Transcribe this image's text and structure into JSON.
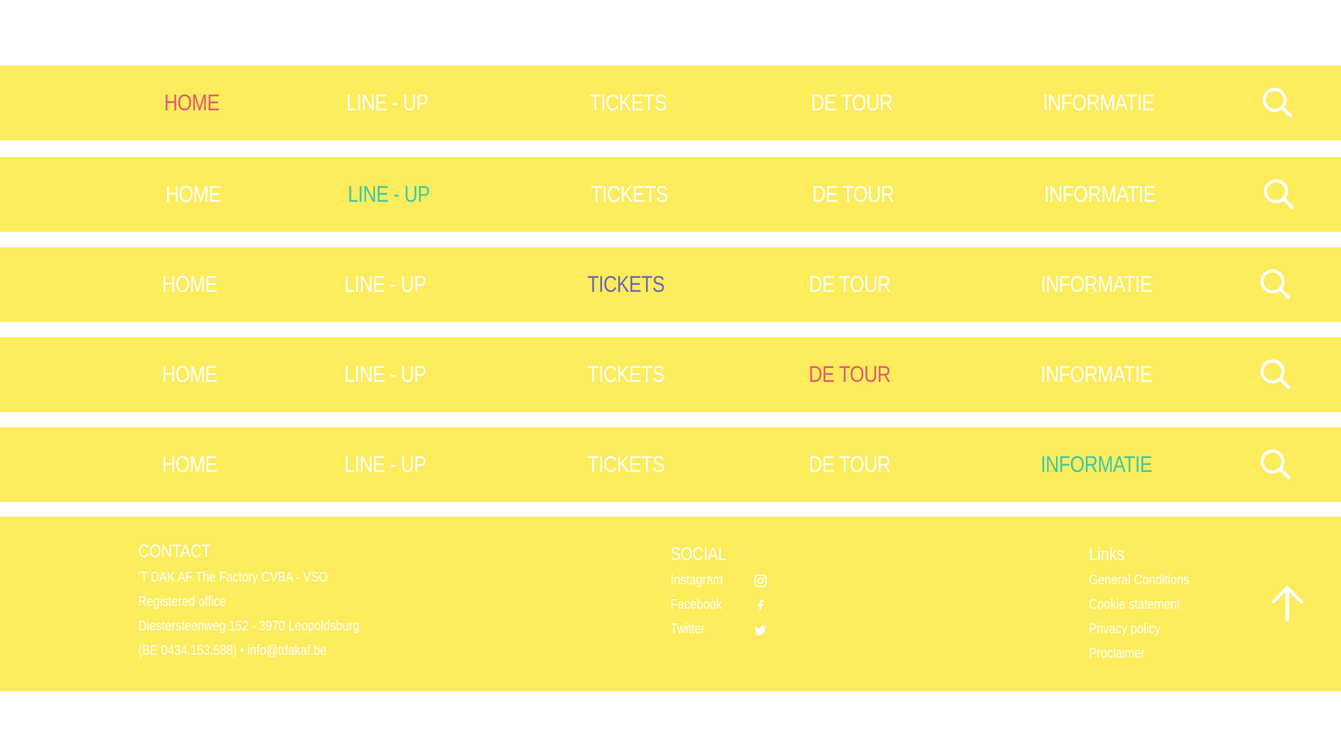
{
  "colors": {
    "bar": "#fdec5c",
    "default_text": "#ffffff",
    "home_active": "#e35a6c",
    "lineup_active": "#3dc9a5",
    "tickets_active": "#6b68b7",
    "detour_active": "#e35a6c",
    "informatie_active": "#3dc9a5"
  },
  "nav_variants": [
    {
      "home": "HOME",
      "lineup": "LINE - UP",
      "tickets": "TICKETS",
      "detour": "DE TOUR",
      "informatie": "INFORMATIE",
      "active": "home"
    },
    {
      "home": "HOME",
      "lineup": "LINE - UP",
      "tickets": "TICKETS",
      "detour": "DE TOUR",
      "informatie": "INFORMATIE",
      "active": "lineup"
    },
    {
      "home": "HOME",
      "lineup": "LINE - UP",
      "tickets": "TICKETS",
      "detour": "DE TOUR",
      "informatie": "INFORMATIE",
      "active": "tickets"
    },
    {
      "home": "HOME",
      "lineup": "LINE - UP",
      "tickets": "TICKETS",
      "detour": "DE TOUR",
      "informatie": "INFORMATIE",
      "active": "detour"
    },
    {
      "home": "HOME",
      "lineup": "LINE - UP",
      "tickets": "TICKETS",
      "detour": "DE TOUR",
      "informatie": "INFORMATIE",
      "active": "informatie"
    }
  ],
  "icons": {
    "search": "search-icon",
    "instagram": "instagram-icon",
    "facebook": "facebook-icon",
    "twitter": "twitter-icon",
    "back_to_top": "arrow-up-icon"
  },
  "footer": {
    "contact": {
      "heading": "CONTACT",
      "line1": "'T DAK AF The Factory CVBA - VSO",
      "line2": "Registered office",
      "line3": "Diestersteenweg 152 - 3970 Leopoldsburg",
      "line4": "(BE 0434.153.588) • info@tdakaf.be"
    },
    "social": {
      "heading": "SOCIAL",
      "instagram": "Instagram",
      "facebook": "Facebook",
      "twitter": "Twitter"
    },
    "links": {
      "heading": "Links",
      "general": "General Conditions",
      "cookie": "Cookie statement",
      "privacy": "Privacy policy",
      "proclaimer": "Proclaimer"
    }
  }
}
